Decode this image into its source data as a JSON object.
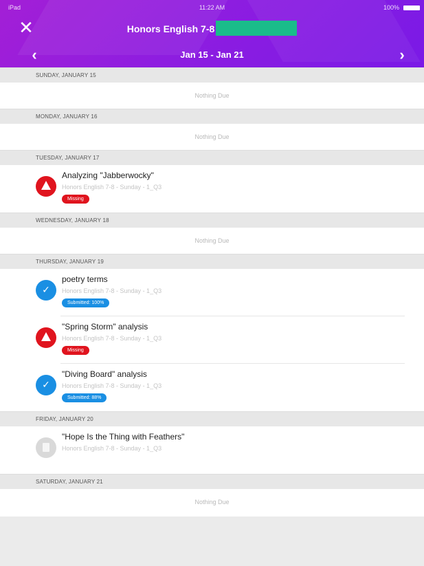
{
  "status_bar": {
    "left": "iPad",
    "time": "11:22 AM",
    "right": "100%"
  },
  "header": {
    "close_icon": "close-icon",
    "class_title": "Honors English 7-8",
    "week_range": "Jan 15 - Jan 21",
    "prev_icon": "chevron-left-icon",
    "next_icon": "chevron-right-icon",
    "gradient_start": "#a31fd6",
    "gradient_end": "#7a1ae6",
    "redaction_color": "#1abc8a"
  },
  "colors": {
    "missing": "#e0141e",
    "submitted": "#1a8fe3",
    "pending": "#d9d9d9",
    "day_header_bg": "#e7e7e7"
  },
  "days": [
    {
      "label": "SUNDAY, JANUARY 15",
      "empty_text": "Nothing Due"
    },
    {
      "label": "MONDAY, JANUARY 16",
      "empty_text": "Nothing Due"
    },
    {
      "label": "TUESDAY, JANUARY 17",
      "assignments": [
        {
          "title": "Analyzing \"Jabberwocky\"",
          "subtitle": "Honors English 7-8 - Sunday - 1_Q3",
          "status": "missing",
          "badge": "Missing",
          "icon": "alert-icon"
        }
      ]
    },
    {
      "label": "WEDNESDAY, JANUARY 18",
      "empty_text": "Nothing Due"
    },
    {
      "label": "THURSDAY, JANUARY 19",
      "assignments": [
        {
          "title": "poetry terms",
          "subtitle": "Honors English 7-8 - Sunday - 1_Q3",
          "status": "submitted",
          "badge": "Submitted: 100%",
          "icon": "check-icon"
        },
        {
          "title": "\"Spring Storm\" analysis",
          "subtitle": "Honors English 7-8 - Sunday - 1_Q3",
          "status": "missing",
          "badge": "Missing",
          "icon": "alert-icon"
        },
        {
          "title": "\"Diving Board\" analysis",
          "subtitle": "Honors English 7-8 - Sunday - 1_Q3",
          "status": "submitted",
          "badge": "Submitted: 88%",
          "icon": "check-icon"
        }
      ]
    },
    {
      "label": "FRIDAY, JANUARY 20",
      "assignments": [
        {
          "title": "\"Hope Is the Thing with Feathers\"",
          "subtitle": "Honors English 7-8 - Sunday - 1_Q3",
          "status": "pending",
          "badge": "",
          "icon": "document-icon"
        }
      ]
    },
    {
      "label": "SATURDAY, JANUARY 21",
      "empty_text": "Nothing Due"
    }
  ]
}
